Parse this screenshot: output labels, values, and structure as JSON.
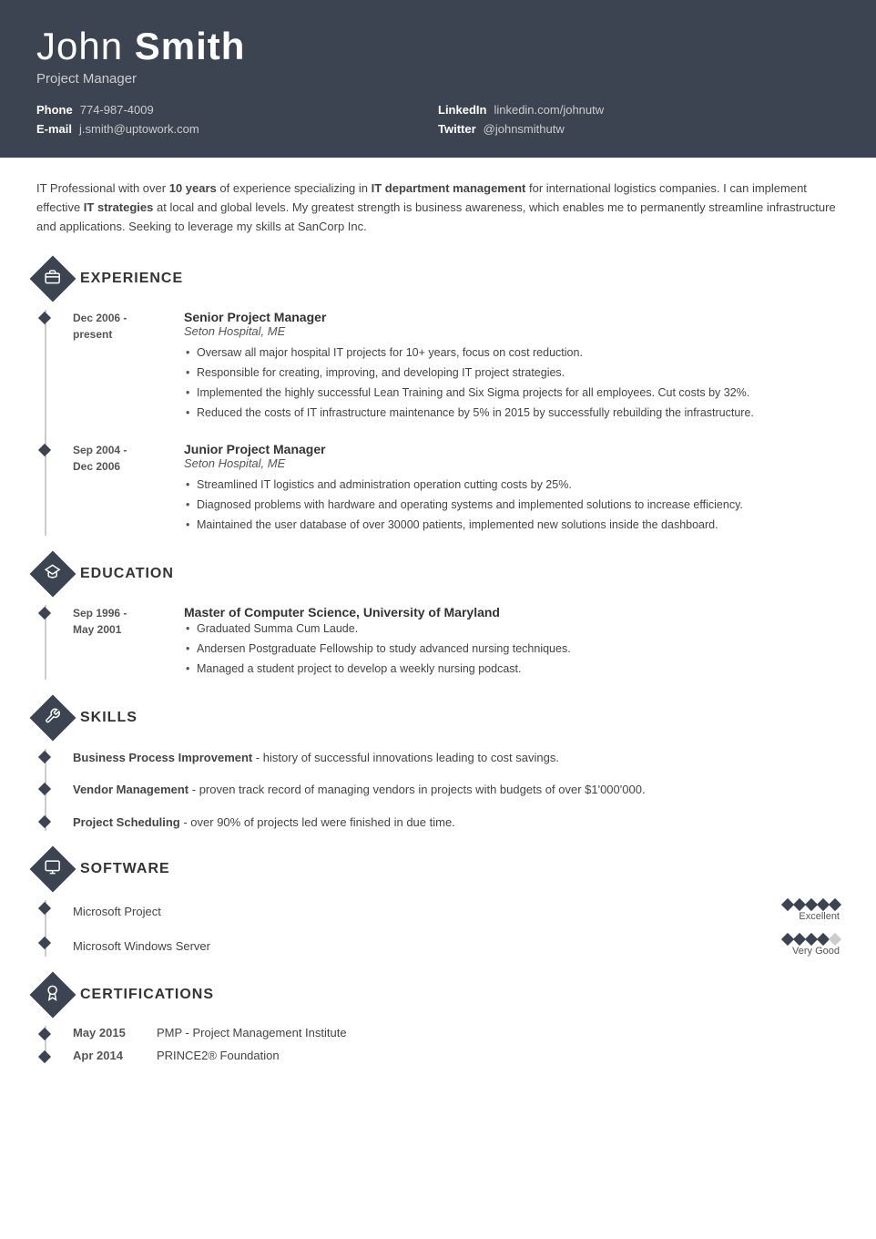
{
  "header": {
    "first_name": "John",
    "last_name": "Smith",
    "title": "Project Manager",
    "contact": {
      "phone_label": "Phone",
      "phone_value": "774-987-4009",
      "linkedin_label": "LinkedIn",
      "linkedin_value": "linkedin.com/johnutw",
      "email_label": "E-mail",
      "email_value": "j.smith@uptowork.com",
      "twitter_label": "Twitter",
      "twitter_value": "@johnsmithutw"
    }
  },
  "summary": {
    "text_before": "IT Professional with over ",
    "bold1": "10 years",
    "text_middle1": " of experience specializing in ",
    "bold2": "IT department management",
    "text_middle2": " for international logistics companies. I can implement effective ",
    "bold3": "IT strategies",
    "text_end": " at local and global levels. My greatest strength is business awareness, which enables me to permanently streamline infrastructure and applications. Seeking to leverage my skills at SanCorp Inc."
  },
  "sections": {
    "experience": {
      "title": "EXPERIENCE",
      "icon": "briefcase",
      "jobs": [
        {
          "date": "Dec 2006 -\npresent",
          "title": "Senior Project Manager",
          "company": "Seton Hospital, ME",
          "bullets": [
            "Oversaw all major hospital IT projects for 10+ years, focus on cost reduction.",
            "Responsible for creating, improving, and developing IT project strategies.",
            "Implemented the highly successful Lean Training and Six Sigma projects for all employees. Cut costs by 32%.",
            "Reduced the costs of IT infrastructure maintenance by 5% in 2015 by successfully rebuilding the infrastructure."
          ]
        },
        {
          "date": "Sep 2004 -\nDec 2006",
          "title": "Junior Project Manager",
          "company": "Seton Hospital, ME",
          "bullets": [
            "Streamlined IT logistics and administration operation cutting costs by 25%.",
            "Diagnosed problems with hardware and operating systems and implemented solutions to increase efficiency.",
            "Maintained the user database of over 30000 patients, implemented new solutions inside the dashboard."
          ]
        }
      ]
    },
    "education": {
      "title": "EDUCATION",
      "icon": "graduation-cap",
      "items": [
        {
          "date": "Sep 1996 -\nMay 2001",
          "title": "Master of Computer Science, University of Maryland",
          "bullets": [
            "Graduated Summa Cum Laude.",
            "Andersen Postgraduate Fellowship to study advanced nursing techniques.",
            "Managed a student project to develop a weekly nursing podcast."
          ]
        }
      ]
    },
    "skills": {
      "title": "SKILLS",
      "icon": "wrench",
      "items": [
        {
          "name": "Business Process Improvement",
          "description": " - history of successful innovations leading to cost savings."
        },
        {
          "name": "Vendor Management",
          "description": " - proven track record of managing vendors in projects with budgets of over $1'000'000."
        },
        {
          "name": "Project Scheduling",
          "description": " - over 90% of projects led were finished in due time."
        }
      ]
    },
    "software": {
      "title": "SOFTWARE",
      "icon": "monitor",
      "items": [
        {
          "name": "Microsoft Project",
          "rating": 5,
          "max": 5,
          "label": "Excellent"
        },
        {
          "name": "Microsoft Windows Server",
          "rating": 4,
          "max": 5,
          "label": "Very Good"
        }
      ]
    },
    "certifications": {
      "title": "CERTIFICATIONS",
      "icon": "badge",
      "items": [
        {
          "date": "May 2015",
          "name": "PMP - Project Management Institute"
        },
        {
          "date": "Apr 2014",
          "name": "PRINCE2® Foundation"
        }
      ]
    }
  }
}
